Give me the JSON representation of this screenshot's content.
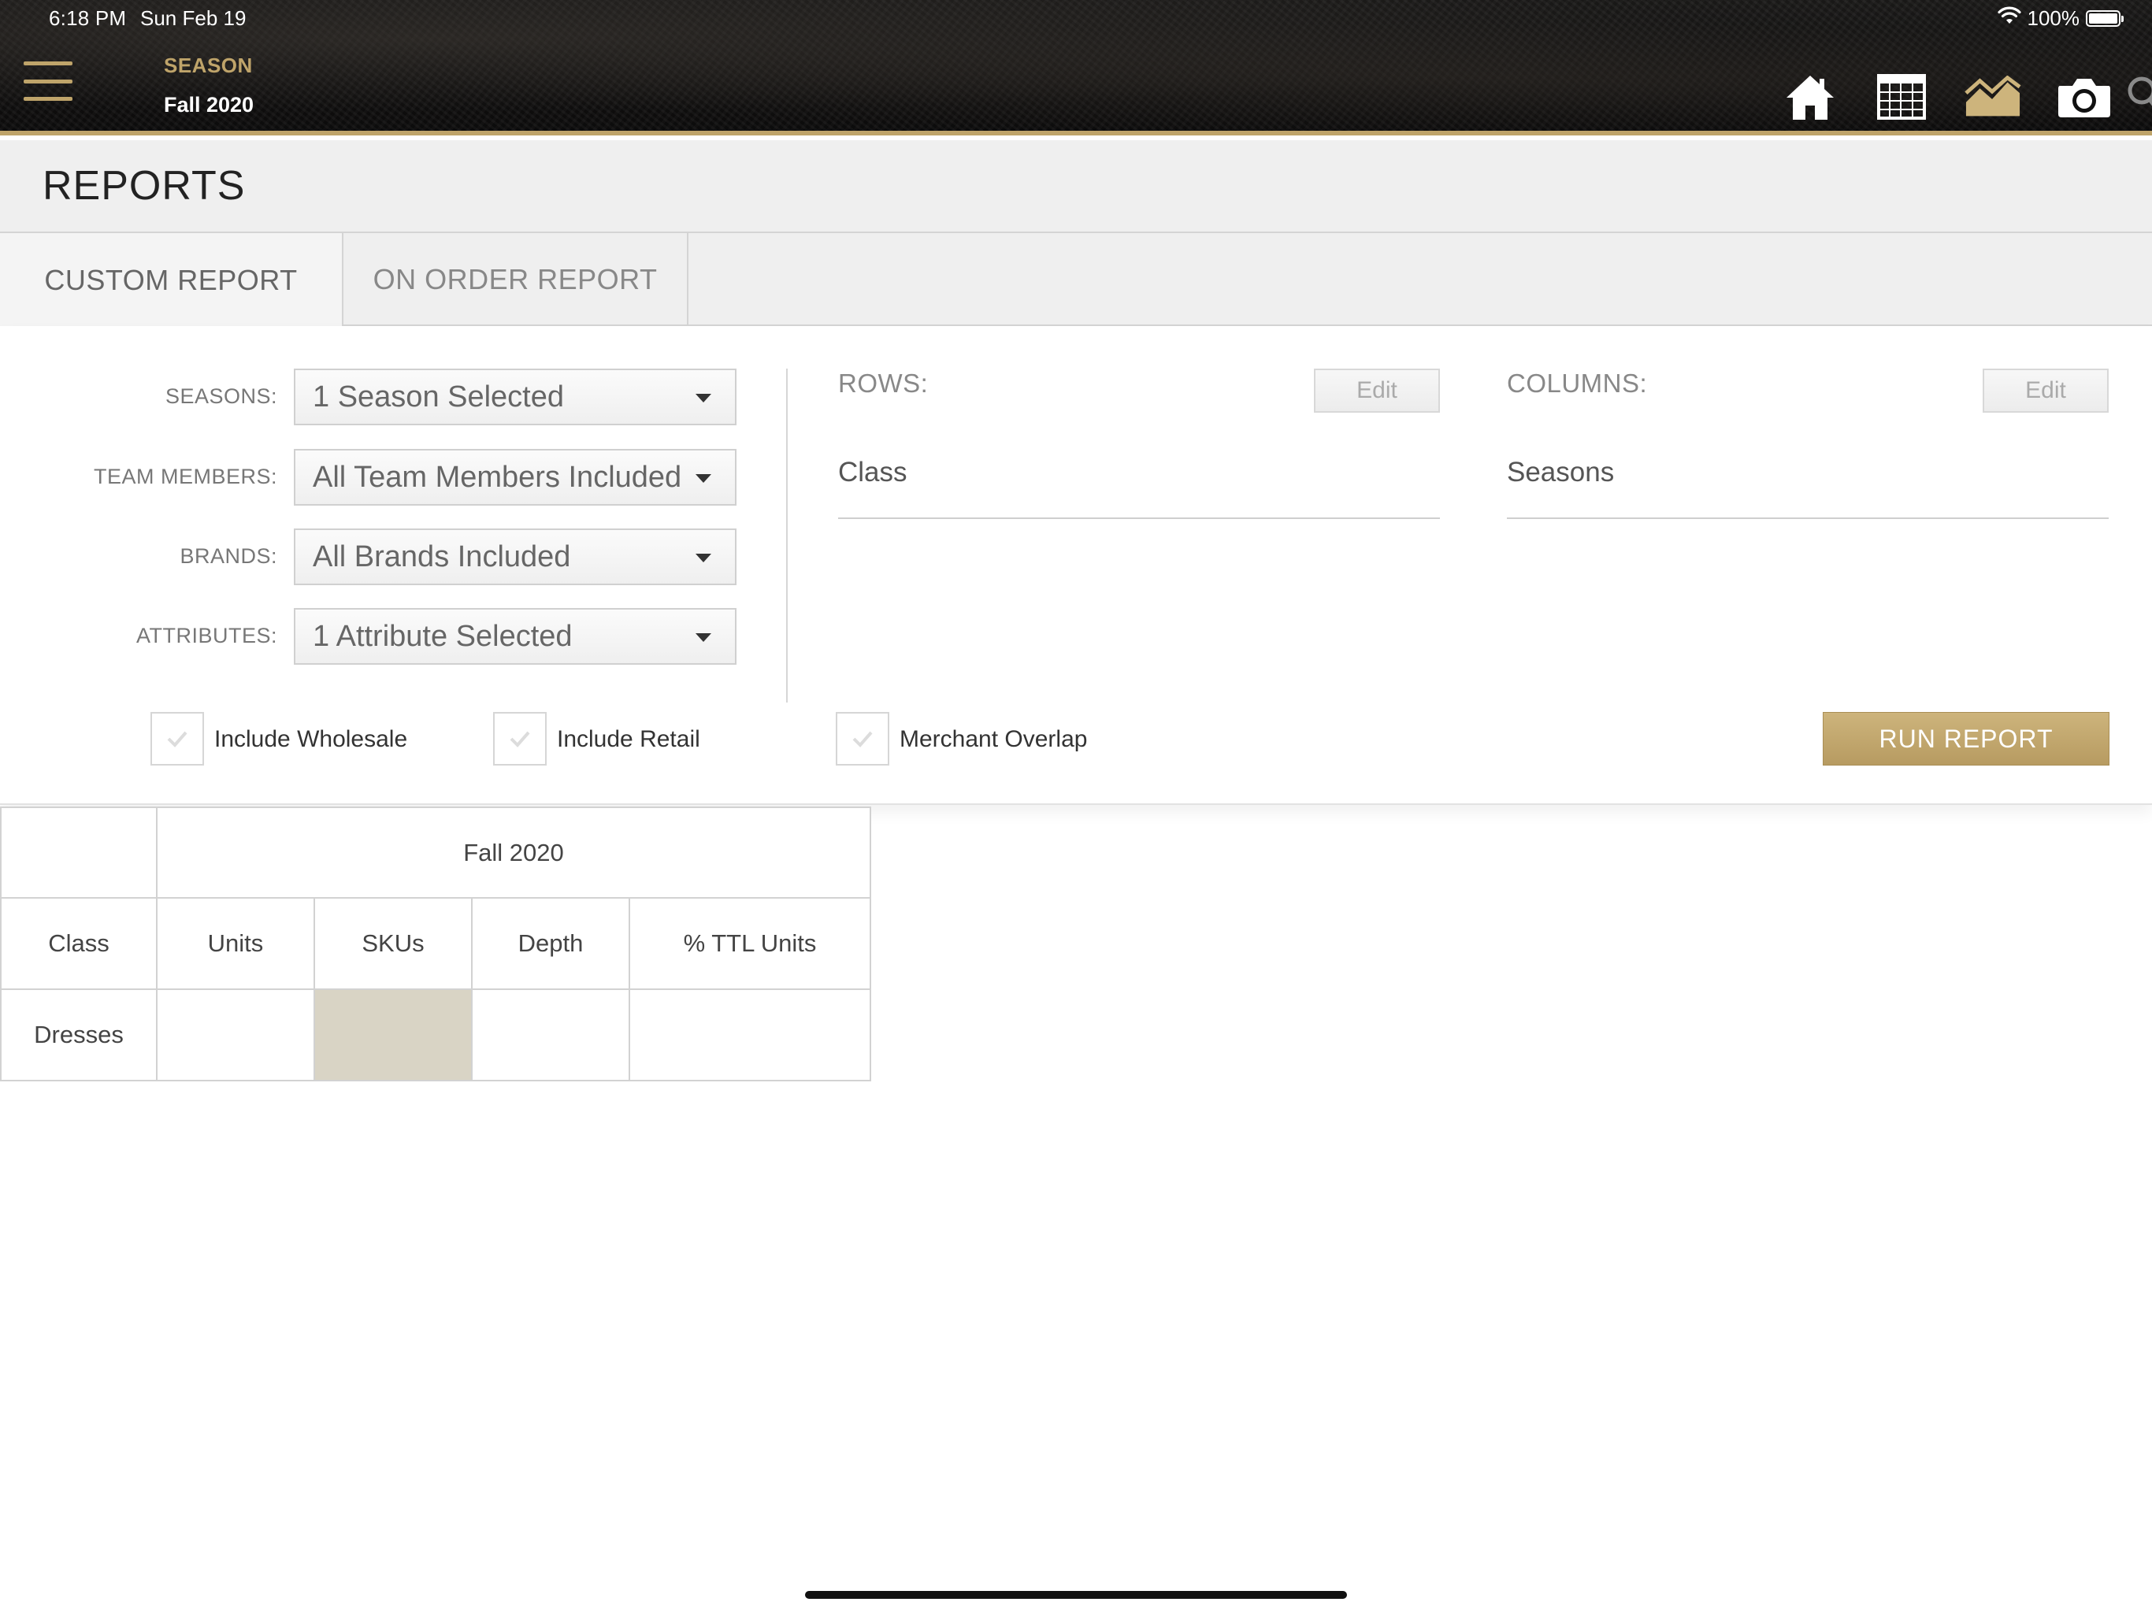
{
  "status_bar": {
    "time": "6:18 PM",
    "date": "Sun Feb 19",
    "battery": "100%"
  },
  "header": {
    "season_label": "SEASON",
    "season_value": "Fall 2020",
    "nav_icons": [
      "home-icon",
      "grid-icon",
      "chart-icon",
      "camera-icon",
      "search-icon"
    ],
    "accent_color": "#bfa46a"
  },
  "page": {
    "title": "REPORTS"
  },
  "tabs": [
    {
      "label": "CUSTOM REPORT",
      "active": true
    },
    {
      "label": "ON ORDER REPORT",
      "active": false
    }
  ],
  "filters": {
    "seasons": {
      "label": "SEASONS:",
      "value": "1 Season Selected"
    },
    "team_members": {
      "label": "TEAM MEMBERS:",
      "value": "All Team Members Included"
    },
    "brands": {
      "label": "BRANDS:",
      "value": "All Brands Included"
    },
    "attributes": {
      "label": "ATTRIBUTES:",
      "value": "1 Attribute Selected"
    }
  },
  "rows_section": {
    "label": "ROWS:",
    "edit_label": "Edit",
    "value": "Class"
  },
  "columns_section": {
    "label": "COLUMNS:",
    "edit_label": "Edit",
    "value": "Seasons"
  },
  "options": {
    "include_wholesale": "Include Wholesale",
    "include_retail": "Include Retail",
    "merchant_overlap": "Merchant Overlap"
  },
  "run_report_label": "RUN REPORT",
  "results_table": {
    "group_header": "Fall 2020",
    "columns": [
      "Class",
      "Units",
      "SKUs",
      "Depth",
      "% TTL Units"
    ],
    "rows": [
      {
        "class": "Dresses",
        "units": "",
        "skus": "",
        "depth": "",
        "pct_ttl_units": ""
      }
    ]
  }
}
